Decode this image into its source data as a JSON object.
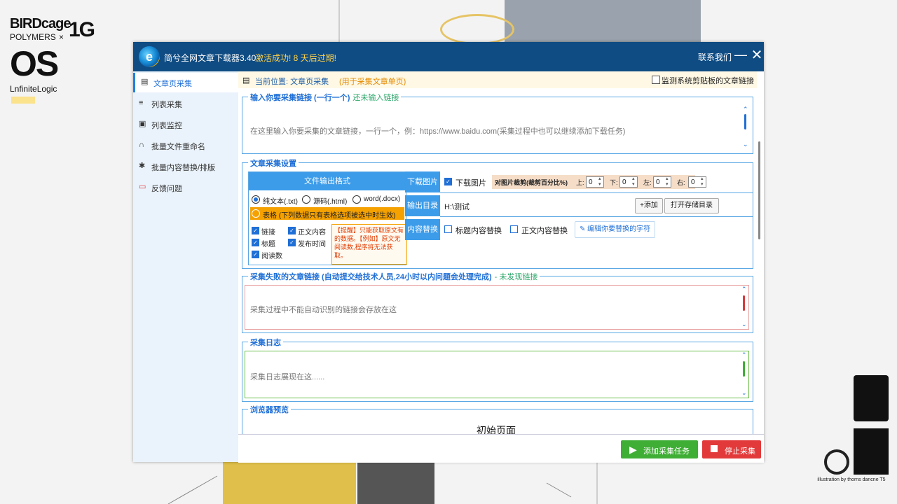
{
  "poster": {
    "brand_line1": "BIRDcage",
    "brand_line2": "POLYMERS",
    "brand_x": "×",
    "brand_1g": "1G",
    "brand_os": "OS",
    "brand_sub": "LnfiniteLogic",
    "credit": "illustration by thorns dancne T5"
  },
  "titlebar": {
    "app_title": "简兮全网文章下载器3.40",
    "activation": "激活成功! 8 天后过期!",
    "contact": "联系我们",
    "minimize_glyph": "—",
    "close_glyph": "✕"
  },
  "sidebar": {
    "items": [
      {
        "label": "文章页采集",
        "icon": "document-icon",
        "active": true
      },
      {
        "label": "列表采集",
        "icon": "list-search-icon",
        "active": false
      },
      {
        "label": "列表监控",
        "icon": "monitor-icon",
        "active": false
      },
      {
        "label": "批量文件重命名",
        "icon": "headset-icon",
        "active": false
      },
      {
        "label": "批量内容替换/排版",
        "icon": "replace-icon",
        "active": false
      },
      {
        "label": "反馈问题",
        "icon": "feedback-icon",
        "active": false
      }
    ]
  },
  "location": {
    "text": "当前位置: 文章页采集",
    "note": "(用于采集文章单页)",
    "clipboard_label": "监测系统剪贴板的文章链接",
    "clipboard_checked": false
  },
  "links_group": {
    "title": "输入你要采集链接 (一行一个)",
    "hint": "还未输入链接",
    "placeholder": "在这里输入你要采集的文章链接，一行一个，例：https://www.baidu.com(采集过程中也可以继续添加下载任务)"
  },
  "settings_group": {
    "title": "文章采集设置",
    "format_header": "文件输出格式",
    "formats": [
      {
        "label": "纯文本(.txt)",
        "selected": true
      },
      {
        "label": "源码(.html)",
        "selected": false
      },
      {
        "label": "word(.docx)",
        "selected": false
      }
    ],
    "table_option": "表格 (下列数据只有表格选项被选中时生效)",
    "fields": [
      {
        "label": "链接",
        "checked": true
      },
      {
        "label": "正文内容",
        "checked": true
      },
      {
        "label": "标题",
        "checked": true
      },
      {
        "label": "发布时间",
        "checked": true
      },
      {
        "label": "阅读数",
        "checked": true
      }
    ],
    "tip": "【提醒】只能获取原文有的数据。【例如】原文无阅读数,程序将无法获取。",
    "download_images": {
      "row_label": "下载图片",
      "checkbox_label": "下载图片",
      "checked": true,
      "crop_label": "对图片裁剪(裁剪百分比%)",
      "top_label": "上:",
      "top_value": "0",
      "bottom_label": "下:",
      "bottom_value": "0",
      "left_label": "左:",
      "left_value": "0",
      "right_label": "右:",
      "right_value": "0"
    },
    "output_dir": {
      "row_label": "输出目录",
      "value": "H:\\测试",
      "add_button": "+添加",
      "open_button": "打开存储目录"
    },
    "content_replace": {
      "row_label": "内容替换",
      "title_replace": "标题内容替换",
      "body_replace": "正文内容替换",
      "edit_button": "编辑你要替换的字符"
    }
  },
  "failed_group": {
    "title": "采集失败的文章链接 (自动提交给技术人员,24小时以内问题会处理完成)",
    "hint": "- 未发现链接",
    "placeholder": "采集过程中不能自动识别的链接会存放在这"
  },
  "log_group": {
    "title": "采集日志",
    "placeholder": "采集日志展现在这......"
  },
  "browser_group": {
    "title": "浏览器预览",
    "page_title": "初始页面"
  },
  "actions": {
    "add_task": "添加采集任务",
    "stop": "停止采集"
  },
  "colors": {
    "titlebar": "#0f4c83",
    "accent": "#3c9cea",
    "green": "#3fae35",
    "red": "#e2393a",
    "warning": "#f5a100"
  }
}
